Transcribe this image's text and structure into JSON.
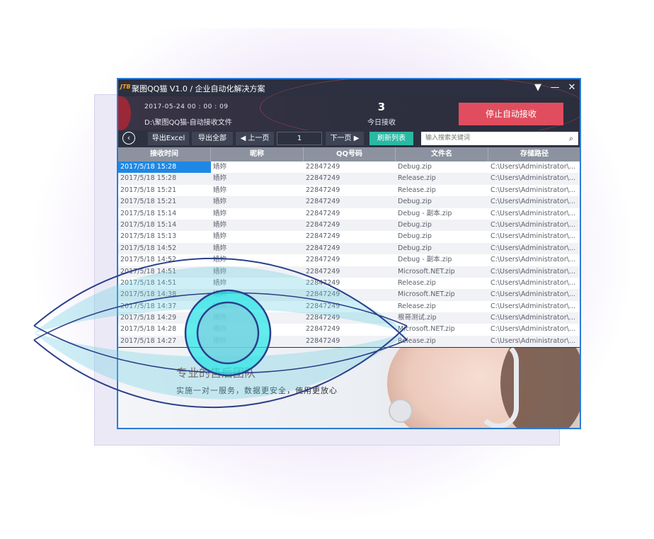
{
  "window": {
    "logo_text": "JTB",
    "title": "聚图QQ猫 V1.0 / 企业自动化解决方案",
    "controls": [
      "▼",
      "—",
      "✕"
    ]
  },
  "header": {
    "datetime": "2017-05-24 00 : 00 : 09",
    "path": "D:\\聚图QQ猫-自动接收文件",
    "count": "3",
    "count_label": "今日接收",
    "stop_button": "停止自动接收"
  },
  "toolbar": {
    "back_glyph": "‹",
    "export_excel": "导出Excel",
    "export_all": "导出全部",
    "prev_page": "◀ 上一页",
    "page_number": "1",
    "next_page": "下一页 ▶",
    "refresh": "刷新列表",
    "search_placeholder": "输入搜索关键词",
    "search_glyph": "⌕"
  },
  "table": {
    "columns": [
      "接收时间",
      "昵称",
      "QQ号码",
      "文件名",
      "存储路径"
    ],
    "rows": [
      [
        "2017/5/18 15:28",
        "嫱妳",
        "22847249",
        "Debug.zip",
        "C:\\Users\\Administrator\\..."
      ],
      [
        "2017/5/18 15:28",
        "嫱妳",
        "22847249",
        "Release.zip",
        "C:\\Users\\Administrator\\..."
      ],
      [
        "2017/5/18 15:21",
        "嫱妳",
        "22847249",
        "Release.zip",
        "C:\\Users\\Administrator\\..."
      ],
      [
        "2017/5/18 15:21",
        "嫱妳",
        "22847249",
        "Debug.zip",
        "C:\\Users\\Administrator\\..."
      ],
      [
        "2017/5/18 15:14",
        "嫱妳",
        "22847249",
        "Debug - 副本.zip",
        "C:\\Users\\Administrator\\..."
      ],
      [
        "2017/5/18 15:14",
        "嫱妳",
        "22847249",
        "Debug.zip",
        "C:\\Users\\Administrator\\..."
      ],
      [
        "2017/5/18 15:13",
        "嫱妳",
        "22847249",
        "Debug.zip",
        "C:\\Users\\Administrator\\..."
      ],
      [
        "2017/5/18 14:52",
        "嫱妳",
        "22847249",
        "Debug.zip",
        "C:\\Users\\Administrator\\..."
      ],
      [
        "2017/5/18 14:52",
        "嫱妳",
        "22847249",
        "Debug - 副本.zip",
        "C:\\Users\\Administrator\\..."
      ],
      [
        "2017/5/18 14:51",
        "嫱妳",
        "22847249",
        "Microsoft.NET.zip",
        "C:\\Users\\Administrator\\..."
      ],
      [
        "2017/5/18 14:51",
        "嫱妳",
        "22847249",
        "Release.zip",
        "C:\\Users\\Administrator\\..."
      ],
      [
        "2017/5/18 14:38",
        "嫱妳",
        "22847249",
        "Microsoft.NET.zip",
        "C:\\Users\\Administrator\\..."
      ],
      [
        "2017/5/18 14:37",
        "嫱妳",
        "22847249",
        "Release.zip",
        "C:\\Users\\Administrator\\..."
      ],
      [
        "2017/5/18 14:29",
        "嫱妳",
        "22847249",
        "根哥测试.zip",
        "C:\\Users\\Administrator\\..."
      ],
      [
        "2017/5/18 14:28",
        "嫱妳",
        "22847249",
        "Microsoft.NET.zip",
        "C:\\Users\\Administrator\\..."
      ],
      [
        "2017/5/18 14:27",
        "嫱妳",
        "22847249",
        "Release.zip",
        "C:\\Users\\Administrator\\..."
      ]
    ]
  },
  "banner": {
    "title": "专业的售后团队",
    "subtitle": "实施一对一服务，数据更安全，使用更放心"
  },
  "colors": {
    "window_border": "#2a7bd6",
    "stop_button": "#e14d5f",
    "refresh_button": "#29b9a4",
    "selection": "#1e88e5",
    "eye_iris": "#33e0e0",
    "eye_outline": "#2b3f8a"
  }
}
